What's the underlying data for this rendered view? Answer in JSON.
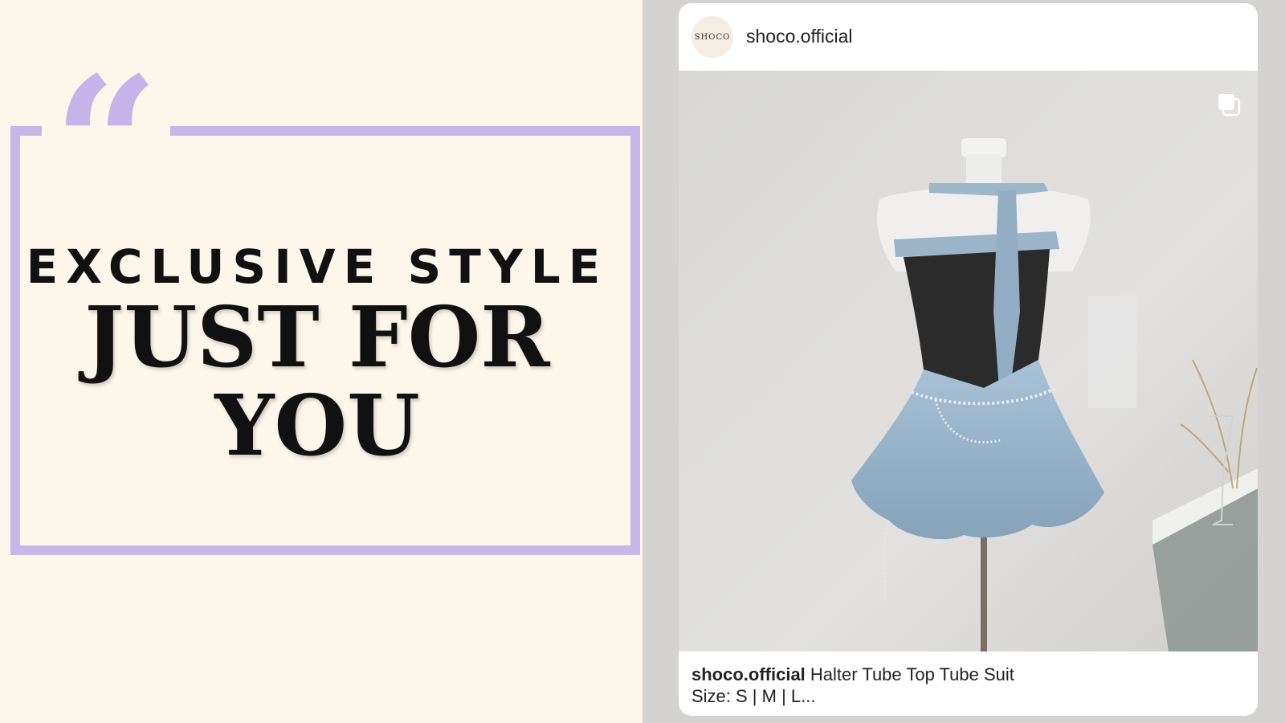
{
  "promo": {
    "quote_glyph": "“",
    "line1": "EXCLUSIVE STYLE",
    "line2": "JUST FOR",
    "line3": "YOU",
    "colors": {
      "background": "#fdf6ea",
      "frame": "#c7b6e8",
      "text": "#111111"
    }
  },
  "post": {
    "avatar_text": "SHOCO",
    "username": "shoco.official",
    "media_icon": "multiple-images-icon",
    "caption_user": "shoco.official",
    "caption_text": "Halter Tube Top Tube Suit",
    "caption_line2": "Size: S | M | L..."
  }
}
